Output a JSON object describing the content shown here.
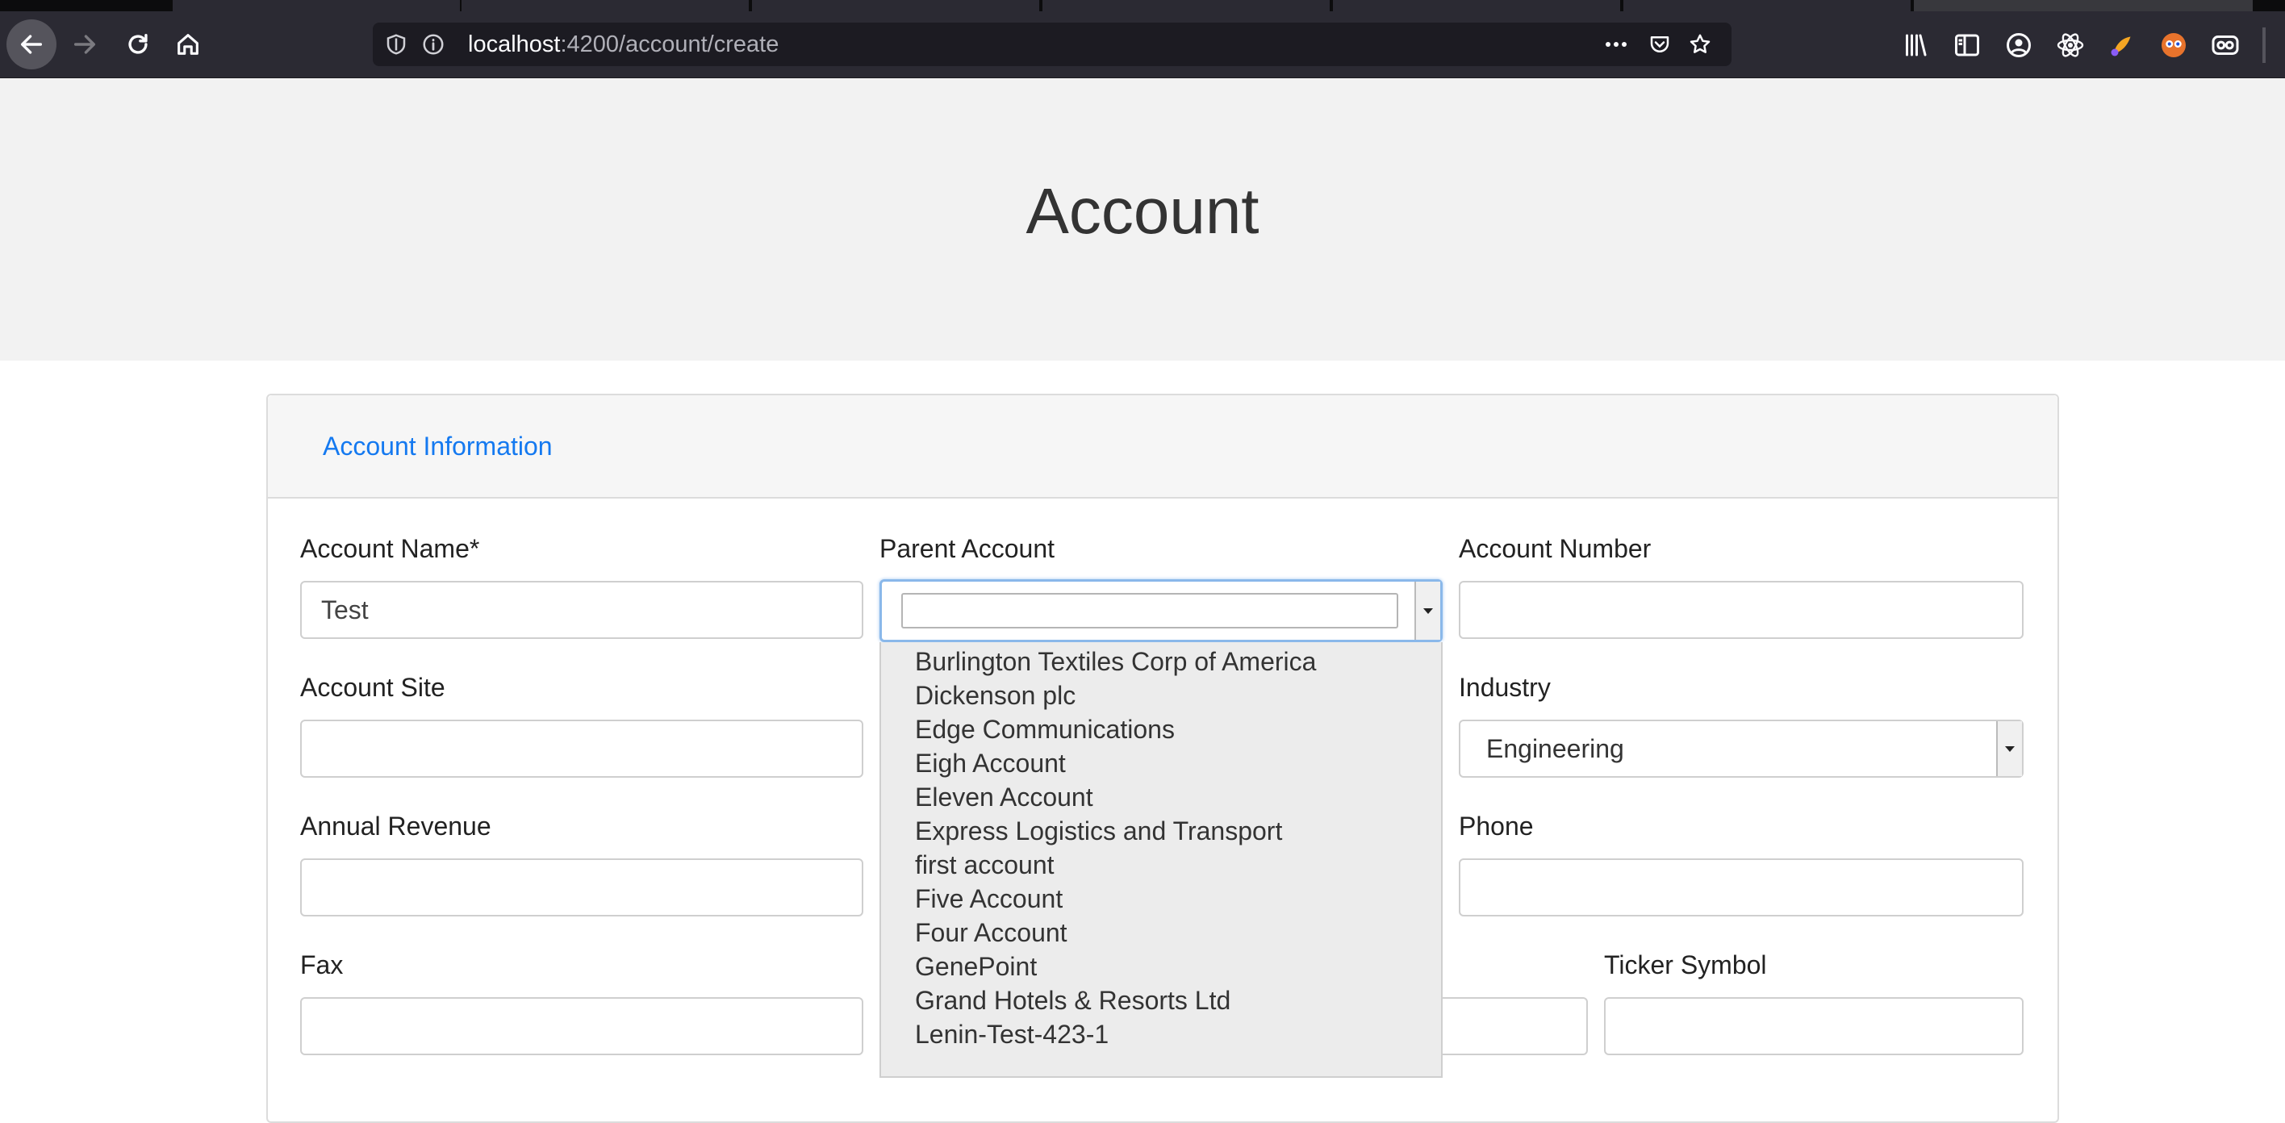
{
  "browser": {
    "url_host": "localhost",
    "url_path": ":4200/account/create"
  },
  "page": {
    "title": "Account",
    "section_tab": "Account Information"
  },
  "form": {
    "account_name_label": "Account Name*",
    "account_name_value": "Test",
    "parent_account_label": "Parent Account",
    "account_number_label": "Account Number",
    "account_site_label": "Account Site",
    "industry_label": "Industry",
    "industry_value": "Engineering",
    "annual_revenue_label": "Annual Revenue",
    "phone_label": "Phone",
    "fax_label": "Fax",
    "ticker_symbol_label": "Ticker Symbol"
  },
  "parent_dropdown": {
    "options": [
      "Burlington Textiles Corp of America",
      "Dickenson plc",
      "Edge Communications",
      "Eigh Account",
      "Eleven Account",
      "Express Logistics and Transport",
      "first account",
      "Five Account",
      "Four Account",
      "GenePoint",
      "Grand Hotels & Resorts Ltd",
      "Lenin-Test-423-1"
    ]
  }
}
